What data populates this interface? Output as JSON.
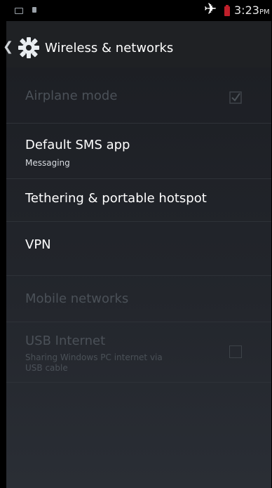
{
  "status_bar": {
    "time": "3:23",
    "ampm": "PM"
  },
  "header": {
    "title": "Wireless & networks"
  },
  "items": [
    {
      "title": "Airplane mode",
      "checked": true,
      "enabled": false
    },
    {
      "title": "Default SMS app",
      "subtitle": "Messaging",
      "enabled": true
    },
    {
      "title": "Tethering & portable hotspot",
      "enabled": true
    },
    {
      "title": "VPN",
      "enabled": true
    },
    {
      "title": "Mobile networks",
      "enabled": false
    },
    {
      "title": "USB Internet",
      "subtitle_line1": "Sharing Windows PC internet via",
      "subtitle_line2": "USB cable",
      "checked": false,
      "enabled": false
    }
  ],
  "icons": {
    "back": "chevron-left-icon",
    "settings": "gear-icon",
    "airplane": "airplane-icon",
    "battery": "battery-icon",
    "notification1": "notification-icon",
    "notification2": "lock-icon"
  }
}
